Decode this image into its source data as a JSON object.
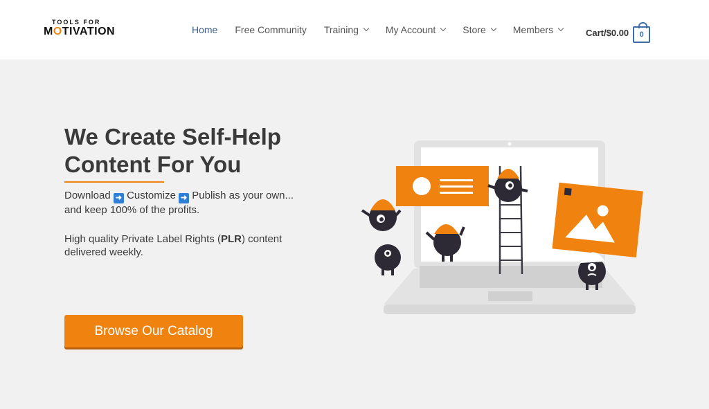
{
  "brand": {
    "logo_top": "TOOLS FOR",
    "logo_main_pre": "M",
    "logo_main_o": "O",
    "logo_main_post": "TIVATION"
  },
  "nav": {
    "items": [
      {
        "label": "Home",
        "active": true,
        "dropdown": false
      },
      {
        "label": "Free Community",
        "active": false,
        "dropdown": false
      },
      {
        "label": "Training",
        "active": false,
        "dropdown": true
      },
      {
        "label": "My Account",
        "active": false,
        "dropdown": true
      },
      {
        "label": "Store",
        "active": false,
        "dropdown": true
      },
      {
        "label": "Members",
        "active": false,
        "dropdown": true
      }
    ],
    "cart_label": "Cart/$0.00",
    "cart_count": "0"
  },
  "hero": {
    "title_line1": "We Create Self-Help",
    "title_line2": "Content For You",
    "tagline_download": "Download",
    "tagline_customize": "Customize",
    "tagline_publish": "Publish as your own...",
    "tagline_line2": "and keep 100% of the profits.",
    "arrow_glyph": "➜",
    "desc_pre": "High quality Private Label Rights (",
    "desc_bold": "PLR",
    "desc_post": ") content",
    "desc_line2": "delivered weekly.",
    "cta_label": "Browse Our Catalog"
  },
  "colors": {
    "accent": "#f0830f",
    "nav_active": "#3d5f8a",
    "cart": "#3d6fa6",
    "background": "#f1f1f1",
    "header": "#ffffff",
    "monster": "#2d2a36"
  }
}
